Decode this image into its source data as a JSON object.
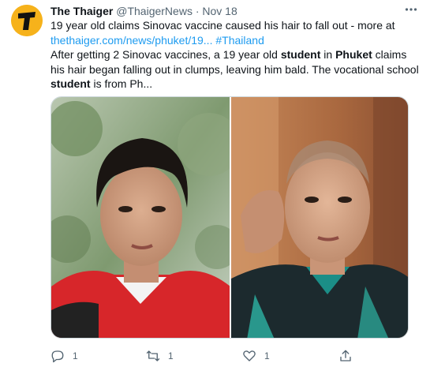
{
  "tweet": {
    "author_name": "The Thaiger",
    "author_handle": "@ThaigerNews",
    "separator": " · ",
    "date": "Nov 18",
    "line1": "19 year old claims Sinovac vaccine caused his hair to fall out - more at",
    "link_url": "thethaiger.com/news/phuket/19...",
    "hashtag": "#Thailand",
    "body_seg1": "After getting 2 Sinovac vaccines, a 19 year old ",
    "body_bold1": "student",
    "body_seg2": " in ",
    "body_bold2": "Phuket",
    "body_seg3": " claims his hair began falling out in clumps, leaving him bald. The vocational school ",
    "body_bold3": "student",
    "body_seg4": " is from Ph..."
  },
  "actions": {
    "reply_count": "1",
    "retweet_count": "1",
    "like_count": "1"
  },
  "icons": {
    "avatar": "thaiger-t-logo",
    "more": "more-dots-icon",
    "reply": "reply-icon",
    "retweet": "retweet-icon",
    "like": "heart-icon",
    "share": "share-icon"
  },
  "colors": {
    "link": "#1d9bf0",
    "muted": "#536471",
    "avatar_bg": "#f6b21b"
  }
}
